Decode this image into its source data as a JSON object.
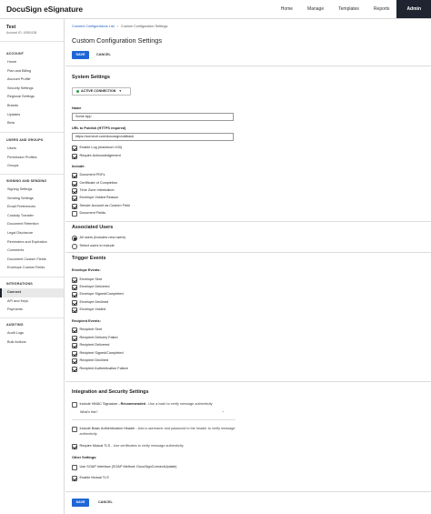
{
  "header": {
    "logo": "DocuSign eSignature",
    "nav": [
      {
        "label": "Home"
      },
      {
        "label": "Manage"
      },
      {
        "label": "Templates"
      },
      {
        "label": "Reports"
      },
      {
        "label": "Admin"
      }
    ]
  },
  "account": {
    "name": "Test",
    "id_text": "Account ID: 10551138"
  },
  "sidebar": {
    "sections": [
      {
        "heading": "ACCOUNT",
        "items": [
          "Home",
          "Plan and Billing",
          "Account Profile",
          "Security Settings",
          "Regional Settings",
          "Brands",
          "Updates",
          "Beta"
        ]
      },
      {
        "heading": "USERS AND GROUPS",
        "items": [
          "Users",
          "Permission Profiles",
          "Groups"
        ]
      },
      {
        "heading": "SIGNING AND SENDING",
        "items": [
          "Signing Settings",
          "Sending Settings",
          "Email Preferences",
          "Custody Transfer",
          "Document Retention",
          "Legal Disclosure",
          "Reminders and Expiration",
          "Comments",
          "Document Custom Fields",
          "Envelope Custom Fields"
        ]
      },
      {
        "heading": "INTEGRATIONS",
        "items": [
          "Connect",
          "API and Keys",
          "Payments"
        ]
      },
      {
        "heading": "AUDITING",
        "items": [
          "Audit Logs",
          "Bulk Actions"
        ]
      }
    ],
    "active_item": "Connect"
  },
  "main": {
    "breadcrumb": {
      "link": "Connect Configurations List",
      "separator": "›",
      "current": "Custom Configuration Settings"
    },
    "title": "Custom Configuration Settings",
    "save_label": "SAVE",
    "cancel_label": "CANCEL",
    "system_settings": {
      "title": "System Settings",
      "status_label": "ACTIVE CONNECTION",
      "status_caret": "▾",
      "name_label": "Name",
      "name_value": "Some App",
      "url_label": "URL to Publish (HTTPS required)",
      "url_value": "https://someurl.com/docusign/callback",
      "options": [
        {
          "label": "Enable Log (maximum 100)",
          "checked": true
        },
        {
          "label": "Require Acknowledgement",
          "checked": true
        }
      ],
      "include_label": "Include:",
      "include": [
        {
          "label": "Document PDFs",
          "checked": true
        },
        {
          "label": "Certificate of Completion",
          "checked": true
        },
        {
          "label": "Time Zone Information",
          "checked": true
        },
        {
          "label": "Envelope Voided Reason",
          "checked": true
        },
        {
          "label": "Sender Account as Custom Field",
          "checked": true
        },
        {
          "label": "Document Fields",
          "checked": false
        }
      ]
    },
    "associated_users": {
      "title": "Associated Users",
      "options": [
        {
          "label": "All users (includes new users)",
          "checked": true
        },
        {
          "label": "Select users to include",
          "checked": false
        }
      ]
    },
    "trigger_events": {
      "title": "Trigger Events",
      "envelope_label": "Envelope Events:",
      "envelope_events": [
        {
          "label": "Envelope Sent",
          "checked": true
        },
        {
          "label": "Envelope Delivered",
          "checked": true
        },
        {
          "label": "Envelope Signed/Completed",
          "checked": true
        },
        {
          "label": "Envelope Declined",
          "checked": true
        },
        {
          "label": "Envelope Voided",
          "checked": true
        }
      ],
      "recipient_label": "Recipient Events:",
      "recipient_events": [
        {
          "label": "Recipient Sent",
          "checked": true
        },
        {
          "label": "Recipient Delivery Failed",
          "checked": true
        },
        {
          "label": "Recipient Delivered",
          "checked": true
        },
        {
          "label": "Recipient Signed/Completed",
          "checked": true
        },
        {
          "label": "Recipient Declined",
          "checked": true
        },
        {
          "label": "Recipient Authentication Failure",
          "checked": true
        }
      ]
    },
    "integration_security": {
      "title": "Integration and Security Settings",
      "hmac_label": "Include HMAC Signature",
      "hmac_recommended": " - Recommended",
      "hmac_desc": " - Use a hash to verify message authenticity",
      "hmac_checked": false,
      "whats_this": "What's this?",
      "chevron": "⌄",
      "basic_auth_label": "Include Basic Authentication Header",
      "basic_auth_desc": " - Add a username and password to the header to verify message authenticity",
      "basic_auth_checked": false,
      "mutual_tls_label": "Require Mutual TLS",
      "mutual_tls_desc": " - Use certificates to verify message authenticity",
      "mutual_tls_checked": true,
      "other_label": "Other Settings:",
      "other": [
        {
          "label": "Use SOAP Interface (SOAP Method: DocuSignConnectUpdate)",
          "checked": false
        },
        {
          "label": "Enable Mutual TLS",
          "checked": true
        }
      ]
    }
  }
}
